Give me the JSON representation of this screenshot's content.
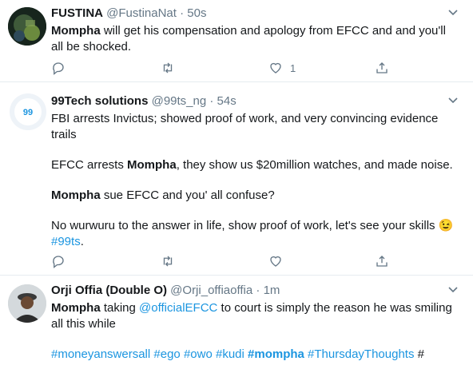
{
  "tweets": [
    {
      "name": "FUSTINA",
      "handle": "@FustinaNat",
      "dot": "·",
      "time": "50s",
      "mention_bold": "Mompha",
      "text": " will get his compensation and apology from EFCC and and you'll all be shocked.",
      "reply_count": "",
      "retweet_count": "",
      "like_count": "1"
    },
    {
      "name": "99Tech solutions",
      "handle": "@99ts_ng",
      "dot": "·",
      "time": "54s",
      "avatar_label": "99",
      "p1": "FBI arrests Invictus; showed proof of work, and very convincing evidence trails",
      "p2_a": "EFCC arrests ",
      "p2_b": "Mompha",
      "p2_c": ", they show us $20million watches, and made noise.",
      "p3_a": "Mompha",
      "p3_b": " sue EFCC and you' all confuse?",
      "p4_a": "No wurwuru to the answer in life, show proof of work, let's see your skills ",
      "emoji": "😉",
      "p4_tag": "#99ts",
      "p4_end": "."
    },
    {
      "name": "Orji Offia (Double O)",
      "handle": "@Orji_offiaoffia",
      "dot": "·",
      "time": "1m",
      "l1_a": "Mompha",
      "l1_b": " taking ",
      "l1_mention": "@officialEFCC",
      "l1_c": " to court is simply the reason he was  smiling all this while",
      "tags": [
        "#moneyanswersall",
        "#ego",
        "#owo",
        "#kudi",
        "#mompha",
        "#ThursdayThoughts",
        "#"
      ]
    }
  ],
  "colors": {
    "accent": "#1b95e0",
    "muted": "#657786",
    "text": "#14171a"
  },
  "icons": [
    "reply-icon",
    "retweet-icon",
    "like-icon",
    "share-icon",
    "chevron-down-icon"
  ]
}
